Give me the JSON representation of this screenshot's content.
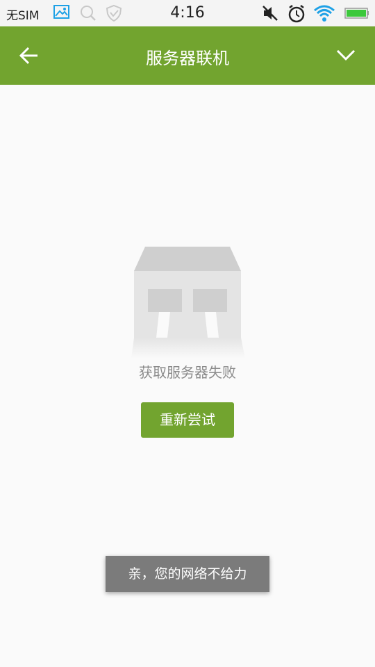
{
  "status_bar": {
    "carrier": "无SIM",
    "time": "4:16",
    "icons": [
      "gallery-notification-icon",
      "search-notification-icon",
      "shield-notification-icon",
      "mute-icon",
      "alarm-icon",
      "wifi-icon",
      "battery-icon"
    ],
    "accent_color": "#1ea1e6",
    "battery_color": "#3cc83c"
  },
  "app_bar": {
    "title": "服务器联机",
    "back_icon": "arrow-left-icon",
    "menu_icon": "chevron-down-icon",
    "color": "#72a42f"
  },
  "content": {
    "illustration_icon": "building-icon",
    "error_message": "获取服务器失败",
    "retry_label": "重新尝试"
  },
  "toast": {
    "message": "亲，您的网络不给力"
  }
}
